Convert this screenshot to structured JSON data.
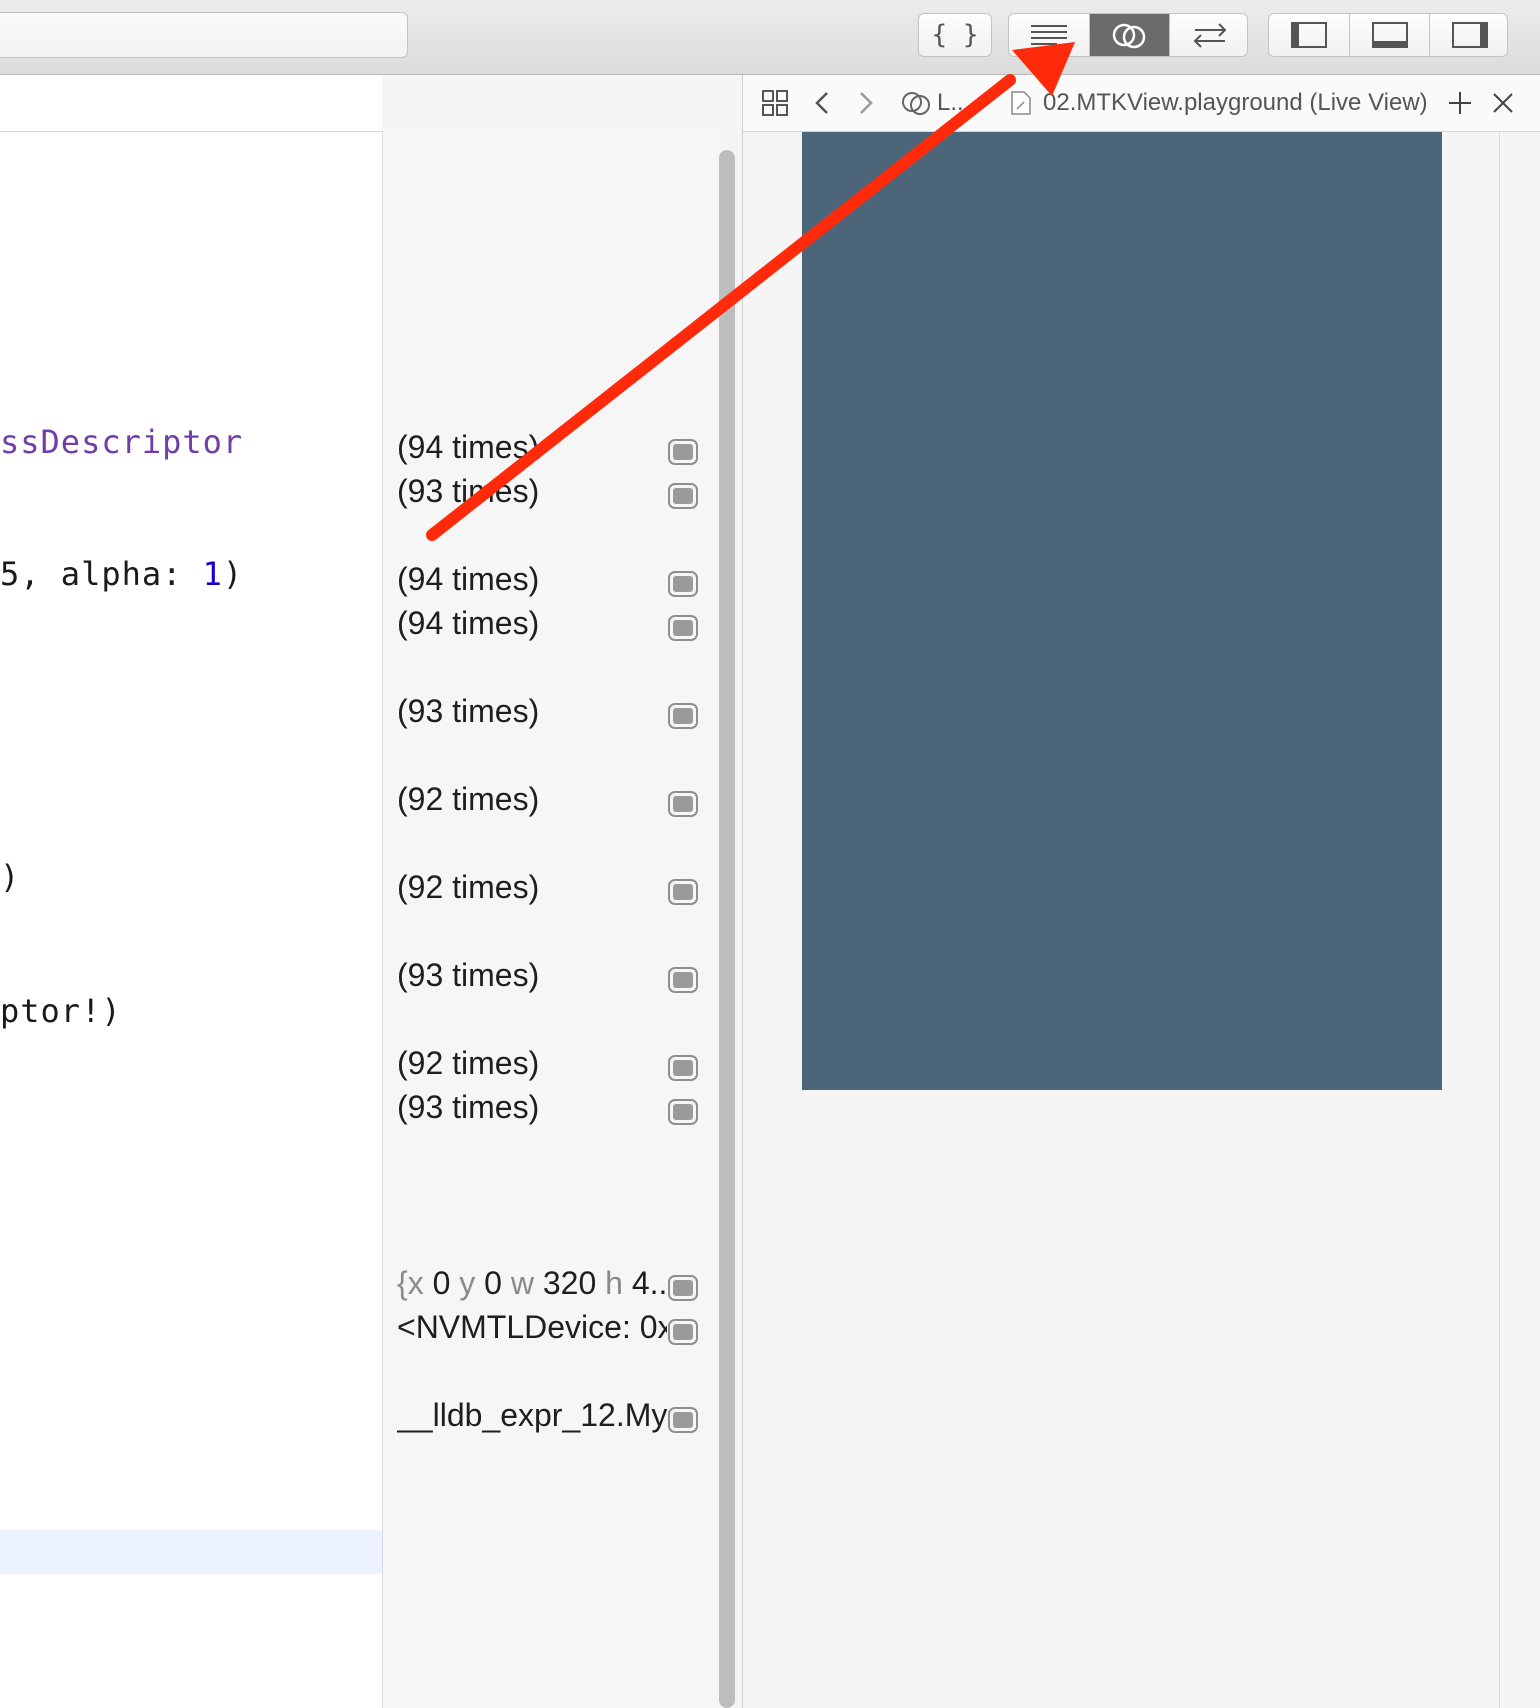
{
  "toolbar": {
    "standard_editor": "Standard Editor",
    "assistant_editor": "Assistant Editor",
    "version_editor": "Version Editor",
    "navigator_toggle": "Show Navigator",
    "debug_toggle": "Show Debug Area",
    "utilities_toggle": "Show Utilities",
    "code_snippet_icon": "braces-icon"
  },
  "editor": {
    "code_lines": [
      {
        "pre": "ssDescriptor",
        "type": true
      },
      {
        "pre": "5, alpha: 1)"
      },
      {
        "pre": ")"
      },
      {
        "pre": "ptor!)"
      }
    ]
  },
  "results": [
    {
      "text": "(94 times)"
    },
    {
      "text": "(93 times)"
    },
    {
      "text": "(94 times)"
    },
    {
      "text": "(94 times)"
    },
    {
      "text": "(93 times)"
    },
    {
      "text": "(92 times)"
    },
    {
      "text": "(92 times)"
    },
    {
      "text": "(93 times)"
    },
    {
      "text": "(92 times)"
    },
    {
      "text": "(93 times)"
    },
    {
      "text_parts": [
        "{x",
        "0",
        "y",
        "0",
        "w",
        "320",
        "h",
        "4..."
      ]
    },
    {
      "text": "<NVMTLDevice: 0x..."
    },
    {
      "text": "__lldb_expr_12.My..."
    }
  ],
  "assistant": {
    "jumpbar_mode": "L...",
    "file_title": "02.MTKView.playground (Live View)",
    "live_view_color": "#4c6579"
  },
  "annotation": {
    "color": "#ff2a0a"
  }
}
